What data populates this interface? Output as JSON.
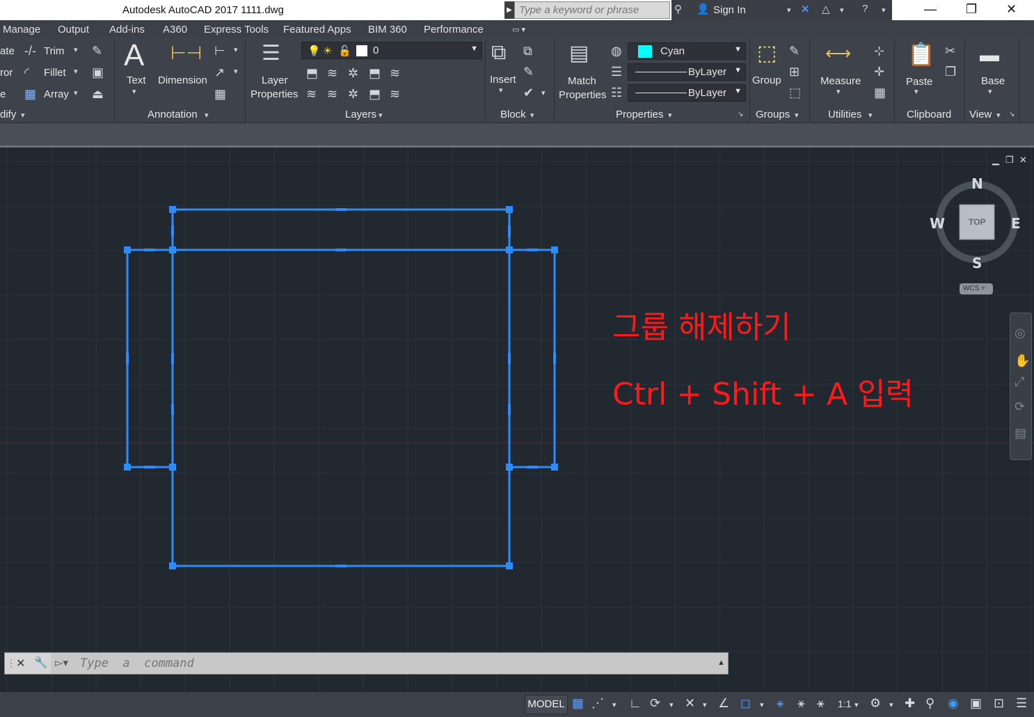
{
  "titlebar": {
    "title": "Autodesk AutoCAD 2017     1111.dwg",
    "search_placeholder": "Type a keyword or phrase",
    "sign_in": "Sign In"
  },
  "tabs": [
    "Manage",
    "Output",
    "Add-ins",
    "A360",
    "Express Tools",
    "Featured Apps",
    "BIM 360",
    "Performance"
  ],
  "ribbon": {
    "modify": {
      "items": [
        "ate",
        "ror",
        "e"
      ],
      "trim": "Trim",
      "fillet": "Fillet",
      "array": "Array",
      "title": "dify"
    },
    "annotation": {
      "text": "Text",
      "dimension": "Dimension",
      "title": "Annotation"
    },
    "layers": {
      "layer_properties_1": "Layer",
      "layer_properties_2": "Properties",
      "current_layer": "0",
      "title": "Layers"
    },
    "block": {
      "insert": "Insert",
      "title": "Block"
    },
    "properties": {
      "match_1": "Match",
      "match_2": "Properties",
      "color": "Cyan",
      "color_hex": "#00ffff",
      "linetype": "ByLayer",
      "lineweight": "ByLayer",
      "title": "Properties"
    },
    "groups": {
      "group": "Group",
      "title": "Groups"
    },
    "utilities": {
      "measure": "Measure",
      "title": "Utilities"
    },
    "clipboard": {
      "paste": "Paste",
      "title": "Clipboard"
    },
    "view": {
      "base": "Base",
      "title": "View"
    }
  },
  "viewcube": {
    "north": "N",
    "south": "S",
    "east": "E",
    "west": "W",
    "face": "TOP",
    "wcs": "WCS"
  },
  "annotations": {
    "line1": "그룹 해제하기",
    "line2": "Ctrl + Shift + A  입력",
    "color": "#ff1a1a"
  },
  "command": {
    "placeholder": "Type  a  command"
  },
  "status": {
    "model": "MODEL",
    "scale": "1:1"
  },
  "colors": {
    "selection": "#2a8cff",
    "canvas": "#212830",
    "grid": "#2b3440"
  }
}
